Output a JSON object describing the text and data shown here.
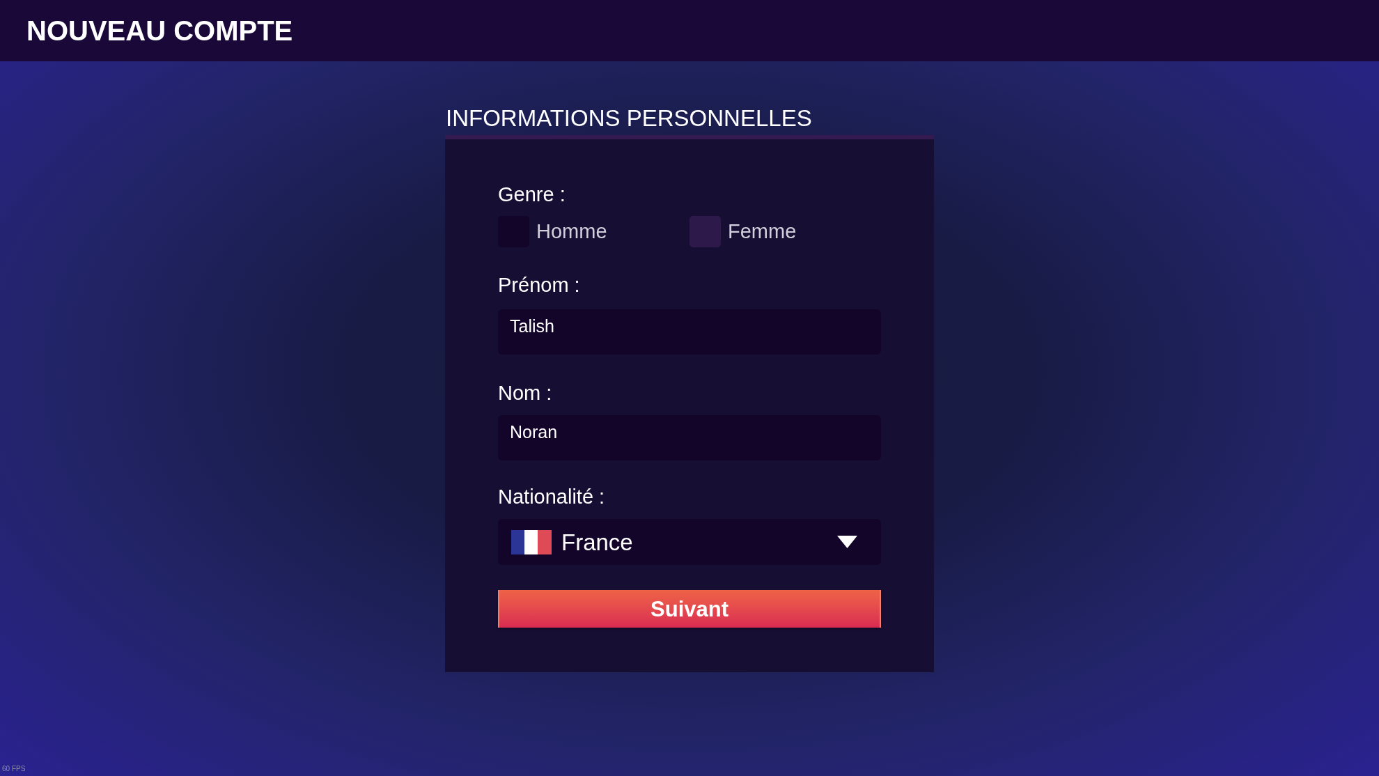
{
  "header": {
    "title": "NOUVEAU COMPTE"
  },
  "section": {
    "title": "INFORMATIONS PERSONNELLES"
  },
  "form": {
    "gender": {
      "label": "Genre :",
      "options": [
        {
          "label": "Homme",
          "selected": false
        },
        {
          "label": "Femme",
          "selected": true
        }
      ]
    },
    "first_name": {
      "label": "Prénom :",
      "value": "Talish"
    },
    "last_name": {
      "label": "Nom :",
      "value": "Noran"
    },
    "nationality": {
      "label": "Nationalité :",
      "value": "France"
    },
    "submit": {
      "label": "Suivant"
    }
  },
  "fps_counter": "60 FPS"
}
